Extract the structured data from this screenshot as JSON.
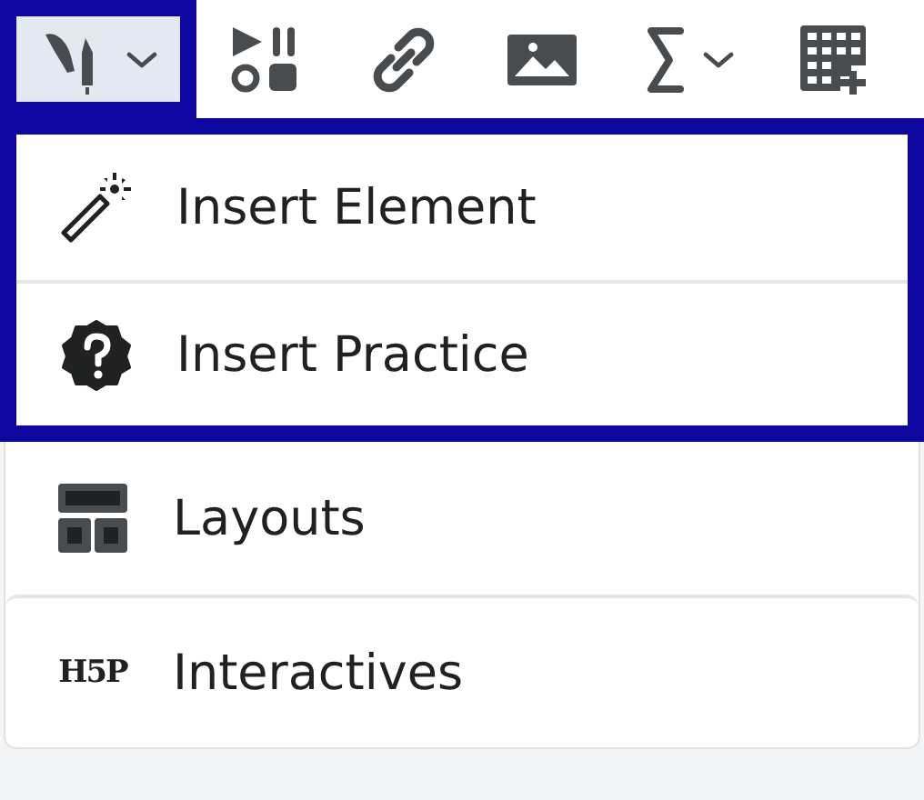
{
  "toolbar": {
    "buttons": [
      {
        "kind": "pen",
        "dropdown": true,
        "highlighted": true,
        "selected": true
      },
      {
        "kind": "media",
        "dropdown": false,
        "highlighted": false,
        "selected": false
      },
      {
        "kind": "link",
        "dropdown": false,
        "highlighted": false,
        "selected": false
      },
      {
        "kind": "image",
        "dropdown": false,
        "highlighted": false,
        "selected": false
      },
      {
        "kind": "sigma",
        "dropdown": true,
        "highlighted": false,
        "selected": false
      },
      {
        "kind": "table",
        "dropdown": false,
        "highlighted": false,
        "selected": false
      }
    ]
  },
  "menu": {
    "items": [
      {
        "kind": "wand",
        "label": "Insert Element",
        "highlighted": true
      },
      {
        "kind": "practice",
        "label": "Insert Practice",
        "highlighted": true
      },
      {
        "kind": "layouts",
        "label": "Layouts",
        "highlighted": false
      },
      {
        "kind": "h5p",
        "icon_text": "H5P",
        "label": "Interactives",
        "highlighted": false
      }
    ]
  }
}
